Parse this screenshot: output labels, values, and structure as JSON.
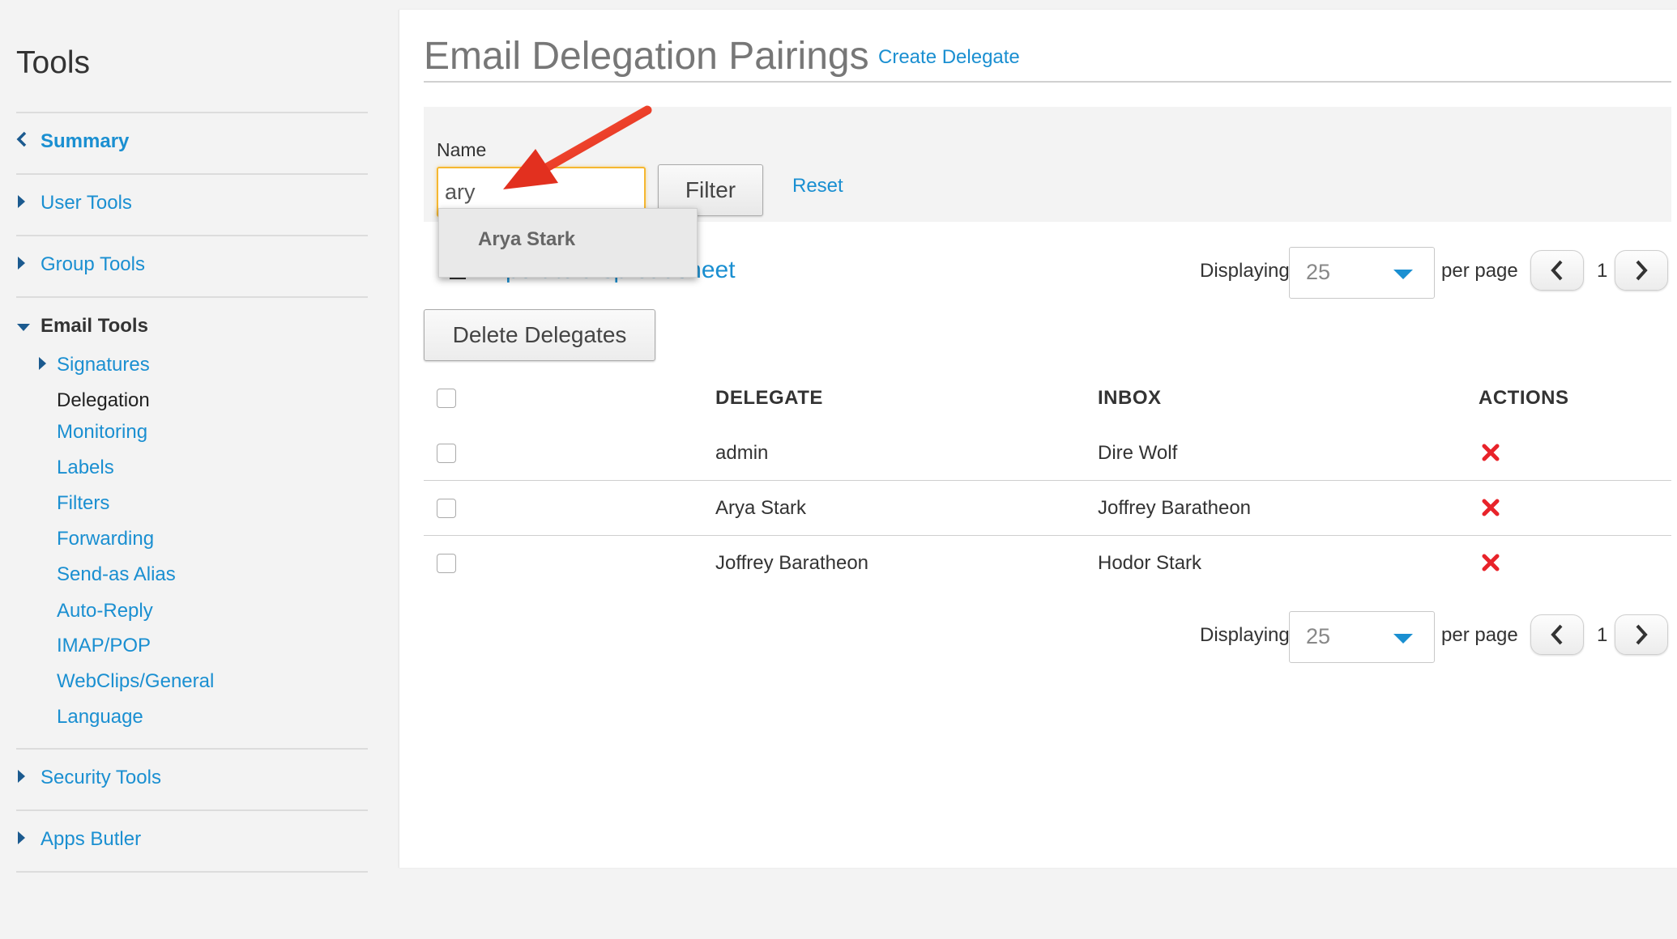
{
  "sidebar": {
    "title": "Tools",
    "sections": [
      {
        "label": "Summary"
      },
      {
        "label": "User Tools"
      },
      {
        "label": "Group Tools"
      },
      {
        "label": "Email Tools"
      },
      {
        "label": "Security Tools"
      },
      {
        "label": "Apps Butler"
      }
    ],
    "email_tools_items": [
      {
        "label": "Signatures"
      },
      {
        "label": "Delegation"
      },
      {
        "label": "Monitoring"
      },
      {
        "label": "Labels"
      },
      {
        "label": "Filters"
      },
      {
        "label": "Forwarding"
      },
      {
        "label": "Send-as Alias"
      },
      {
        "label": "Auto-Reply"
      },
      {
        "label": "IMAP/POP"
      },
      {
        "label": "WebClips/General"
      },
      {
        "label": "Language"
      }
    ]
  },
  "main": {
    "title": "Email Delegation Pairings",
    "create_link": "Create Delegate",
    "filter": {
      "name_label": "Name",
      "name_value": "ary",
      "filter_button": "Filter",
      "reset_link": "Reset",
      "autocomplete": [
        "Arya Stark"
      ]
    },
    "export_link": "Export to a spreadsheet",
    "delete_button": "Delete Delegates",
    "pagination": {
      "displaying_label": "Displaying",
      "per_page_value": "25",
      "per_page_label": "per page",
      "current_page": "1"
    },
    "table": {
      "headers": [
        "DELEGATE",
        "INBOX",
        "ACTIONS"
      ],
      "rows": [
        {
          "delegate": "admin",
          "inbox": "Dire Wolf"
        },
        {
          "delegate": "Arya Stark",
          "inbox": "Joffrey Baratheon"
        },
        {
          "delegate": "Joffrey Baratheon",
          "inbox": "Hodor Stark"
        }
      ]
    }
  },
  "colors": {
    "link": "#1a8fd1",
    "focus_border": "#f5b731",
    "delete_icon": "#e8232a",
    "annotation_arrow": "#e8351f"
  },
  "icons": [
    "chevron-left-icon",
    "triangle-right-icon",
    "triangle-down-icon",
    "caret-down-icon",
    "chevron-right-icon",
    "delete-x-icon",
    "annotation-arrow-icon"
  ]
}
